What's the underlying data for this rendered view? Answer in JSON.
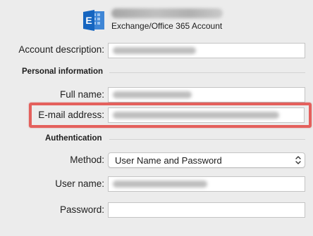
{
  "header": {
    "icon": "exchange-icon",
    "account_type": "Exchange/Office 365 Account"
  },
  "labels": {
    "account_description": "Account description:",
    "full_name": "Full name:",
    "email_address": "E-mail address:",
    "method": "Method:",
    "user_name": "User name:",
    "password": "Password:"
  },
  "sections": {
    "personal_information": "Personal information",
    "authentication": "Authentication"
  },
  "fields": {
    "account_description": "",
    "full_name": "",
    "email_address": "",
    "user_name": "",
    "password": ""
  },
  "method": {
    "selected": "User Name and Password"
  },
  "colors": {
    "highlight": "#e4605c",
    "exchange_blue": "#1565c0"
  }
}
